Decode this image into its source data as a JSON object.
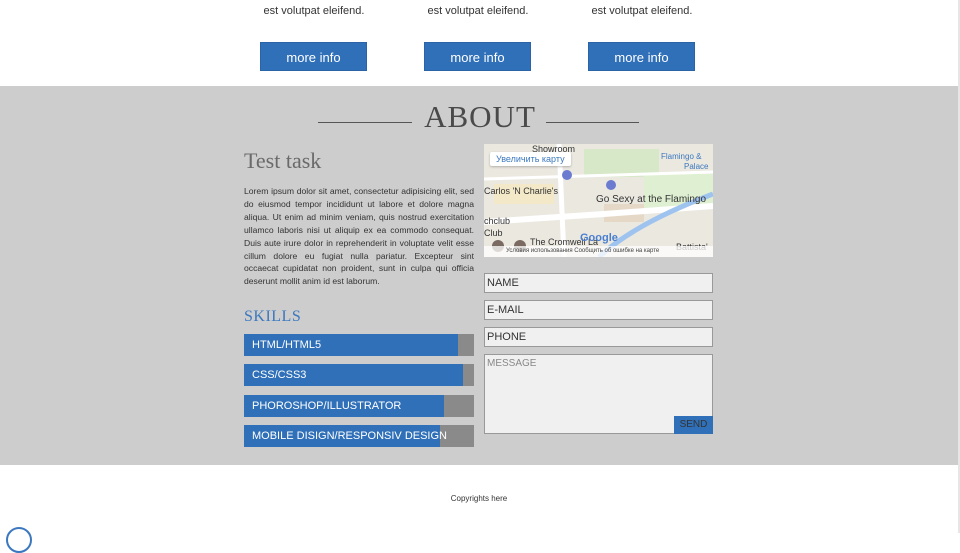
{
  "columns": [
    {
      "text": "est volutpat eleifend.",
      "button": "more info"
    },
    {
      "text": "est volutpat eleifend.",
      "button": "more info"
    },
    {
      "text": "est volutpat eleifend.",
      "button": "more info"
    }
  ],
  "about": {
    "title": "ABOUT",
    "task_title": "Test task",
    "body": "Lorem ipsum dolor sit amet, consectetur adipisicing elit, sed do eiusmod tempor incididunt ut labore et dolore magna aliqua. Ut enim ad minim veniam, quis nostrud exercitation ullamco laboris nisi ut aliquip ex ea commodo consequat. Duis aute irure dolor in reprehenderit in voluptate velit esse cillum dolore eu fugiat nulla pariatur. Excepteur sint occaecat cupidatat non proident, sunt in culpa qui officia deserunt mollit anim id est laborum.",
    "skills_title": "SKILLS",
    "skills": [
      {
        "label": "HTML/HTML5",
        "level": 0.93
      },
      {
        "label": "CSS/CSS3",
        "level": 0.95
      },
      {
        "label": "PHOROSHOP/ILLUSTRATOR",
        "level": 0.87
      },
      {
        "label": "MOBILE DISIGN/RESPONSIV DESIGN",
        "level": 0.85
      }
    ]
  },
  "map": {
    "zoom_button": "Увеличить карту",
    "labels": {
      "showroom": "Showroom",
      "carlos": "Carlos 'N Charlie's",
      "flamingo": "Flamingo &",
      "palace": "Palace",
      "go_sexy": "Go Sexy at the Flamingo",
      "chclub": "chclub",
      "club": "Club",
      "cromwell": "The Cromwell La",
      "battista": "Battista'"
    },
    "footer": "Условия использования  Сообщить об ошибке на карте",
    "google": "Google"
  },
  "form": {
    "name": "NAME",
    "email": "E-MAIL",
    "phone": "PHONE",
    "message": "MESSAGE",
    "send": "SEND"
  },
  "footer": {
    "copyright": "Copyrights here"
  },
  "colors": {
    "accent": "#3070b8",
    "band": "#cdcdcd",
    "skill_bg": "#8a8a8a"
  }
}
